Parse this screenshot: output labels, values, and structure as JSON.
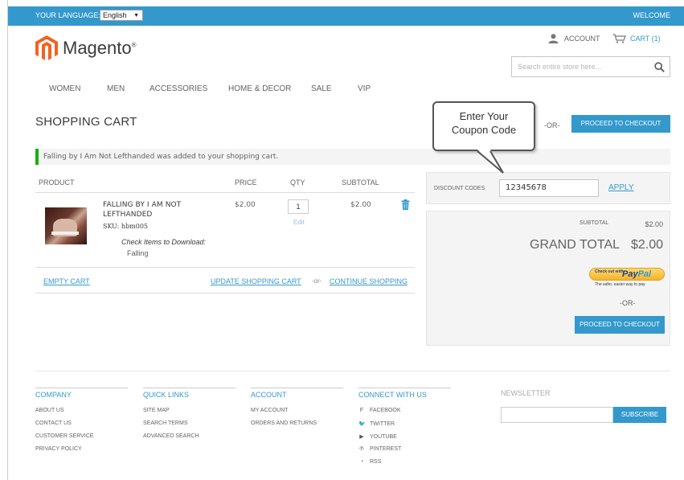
{
  "topbar": {
    "language_label": "Your Language:",
    "language_value": "English",
    "welcome": "Welcome"
  },
  "logo": {
    "brand": "Magento",
    "reg": "®"
  },
  "header": {
    "account": "Account",
    "cart": "Cart (1)",
    "search_placeholder": "Search entire store here..."
  },
  "nav": [
    "Women",
    "Men",
    "Accessories",
    "Home & Decor",
    "Sale",
    "VIP"
  ],
  "page": {
    "title": "Shopping Cart",
    "or": "-OR-",
    "proceed_checkout": "Proceed to Checkout"
  },
  "callout": {
    "line1": "Enter Your",
    "line2": "Coupon Code"
  },
  "message": "Falling by I Am Not Lefthanded was added to your shopping cart.",
  "table": {
    "headers": {
      "product": "Product",
      "price": "Price",
      "qty": "Qty",
      "subtotal": "Subtotal"
    },
    "item": {
      "name": "Falling by I Am Not Lefthanded",
      "sku": "SKU: hbm005",
      "options_label": "Check Items to Download:",
      "option_value": "Falling",
      "price": "$2.00",
      "qty": "1",
      "edit": "Edit",
      "subtotal": "$2.00"
    }
  },
  "cart_actions": {
    "empty": "Empty Cart",
    "update": "Update Shopping Cart",
    "or": "-or-",
    "continue": "Continue Shopping"
  },
  "discount": {
    "label": "Discount Codes",
    "code": "12345678",
    "apply": "Apply"
  },
  "totals": {
    "subtotal_label": "Subtotal",
    "subtotal_value": "$2.00",
    "grand_total_label": "Grand Total",
    "grand_total_value": "$2.00",
    "paypal_checkout": "Check out with",
    "paypal_pay": "Pay",
    "paypal_pal": "Pal",
    "paypal_tagline": "The safer, easier way to pay",
    "or": "-OR-",
    "proceed_checkout": "Proceed to Checkout"
  },
  "footer": {
    "company": {
      "title": "Company",
      "links": [
        "About Us",
        "Contact Us",
        "Customer Service",
        "Privacy Policy"
      ]
    },
    "quick_links": {
      "title": "Quick Links",
      "links": [
        "Site Map",
        "Search Terms",
        "Advanced Search"
      ]
    },
    "account": {
      "title": "Account",
      "links": [
        "My Account",
        "Orders and Returns"
      ]
    },
    "connect": {
      "title": "Connect With Us",
      "links": [
        "Facebook",
        "Twitter",
        "YouTube",
        "Pinterest",
        "RSS"
      ]
    },
    "newsletter": {
      "title": "Newsletter",
      "subscribe": "Subscribe"
    }
  },
  "colors": {
    "accent": "#3399cc",
    "success": "#11b400",
    "panel": "#f4f4f4"
  }
}
